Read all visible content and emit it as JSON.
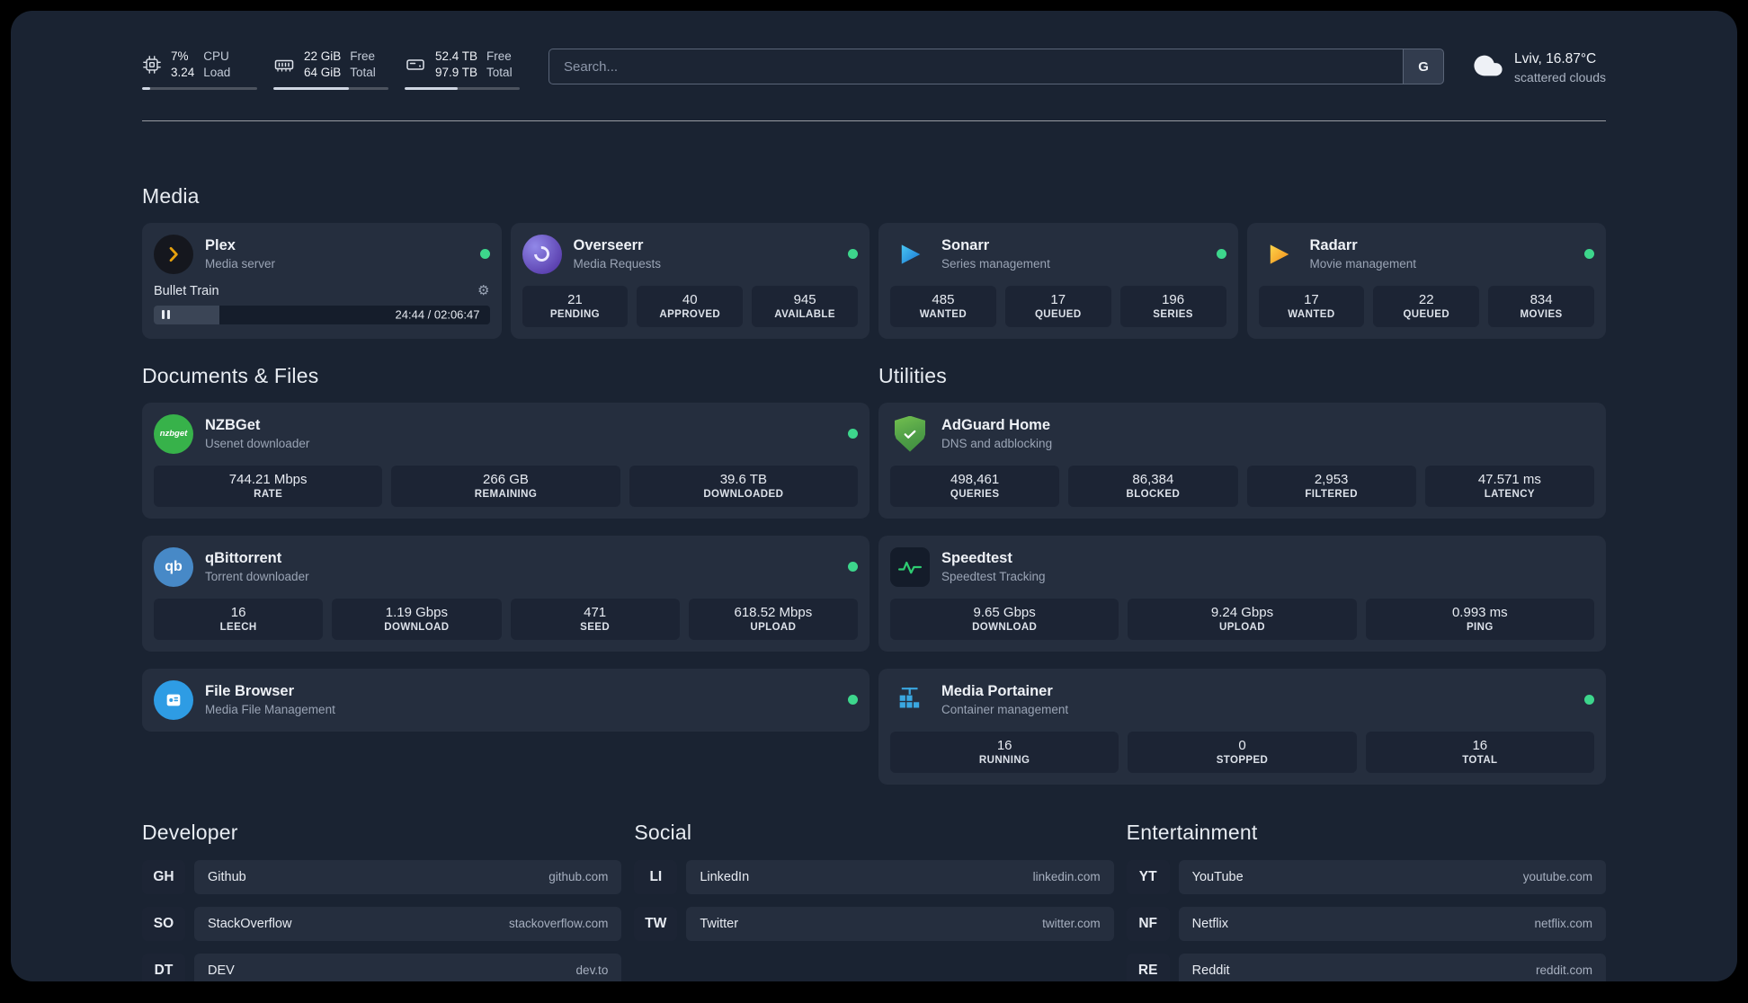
{
  "colors": {
    "status_online": "#3dd68c"
  },
  "icons": {
    "gear": "⚙"
  },
  "header": {
    "cpu": {
      "value_top": "7%",
      "value_bottom": "3.24",
      "label_top": "CPU",
      "label_bottom": "Load",
      "bar_percent": 7
    },
    "memory": {
      "value_top": "22 GiB",
      "value_bottom": "64 GiB",
      "label_top": "Free",
      "label_bottom": "Total",
      "bar_percent": 66
    },
    "disk": {
      "value_top": "52.4 TB",
      "value_bottom": "97.9 TB",
      "label_top": "Free",
      "label_bottom": "Total",
      "bar_percent": 46
    },
    "search": {
      "placeholder": "Search...",
      "button_label": "G"
    },
    "weather": {
      "location": "Lviv, 16.87°C",
      "condition": "scattered clouds"
    }
  },
  "media": {
    "title": "Media",
    "plex": {
      "name": "Plex",
      "subtitle": "Media server",
      "now_playing": {
        "title": "Bullet Train",
        "time": "24:44 / 02:06:47",
        "progress_percent": 19.5
      }
    },
    "overseerr": {
      "name": "Overseerr",
      "subtitle": "Media Requests",
      "stats": [
        {
          "value": "21",
          "label": "PENDING"
        },
        {
          "value": "40",
          "label": "APPROVED"
        },
        {
          "value": "945",
          "label": "AVAILABLE"
        }
      ]
    },
    "sonarr": {
      "name": "Sonarr",
      "subtitle": "Series management",
      "stats": [
        {
          "value": "485",
          "label": "WANTED"
        },
        {
          "value": "17",
          "label": "QUEUED"
        },
        {
          "value": "196",
          "label": "SERIES"
        }
      ]
    },
    "radarr": {
      "name": "Radarr",
      "subtitle": "Movie management",
      "stats": [
        {
          "value": "17",
          "label": "WANTED"
        },
        {
          "value": "22",
          "label": "QUEUED"
        },
        {
          "value": "834",
          "label": "MOVIES"
        }
      ]
    }
  },
  "documents": {
    "title": "Documents & Files",
    "nzbget": {
      "name": "NZBGet",
      "subtitle": "Usenet downloader",
      "icon_text": "nzbget",
      "stats": [
        {
          "value": "744.21 Mbps",
          "label": "RATE"
        },
        {
          "value": "266 GB",
          "label": "REMAINING"
        },
        {
          "value": "39.6 TB",
          "label": "DOWNLOADED"
        }
      ]
    },
    "qbittorrent": {
      "name": "qBittorrent",
      "subtitle": "Torrent downloader",
      "icon_text": "qb",
      "stats": [
        {
          "value": "16",
          "label": "LEECH"
        },
        {
          "value": "1.19 Gbps",
          "label": "DOWNLOAD"
        },
        {
          "value": "471",
          "label": "SEED"
        },
        {
          "value": "618.52 Mbps",
          "label": "UPLOAD"
        }
      ]
    },
    "filebrowser": {
      "name": "File Browser",
      "subtitle": "Media File Management"
    }
  },
  "utilities": {
    "title": "Utilities",
    "adguard": {
      "name": "AdGuard Home",
      "subtitle": "DNS and adblocking",
      "stats": [
        {
          "value": "498,461",
          "label": "QUERIES"
        },
        {
          "value": "86,384",
          "label": "BLOCKED"
        },
        {
          "value": "2,953",
          "label": "FILTERED"
        },
        {
          "value": "47.571 ms",
          "label": "LATENCY"
        }
      ]
    },
    "speedtest": {
      "name": "Speedtest",
      "subtitle": "Speedtest Tracking",
      "stats": [
        {
          "value": "9.65 Gbps",
          "label": "DOWNLOAD"
        },
        {
          "value": "9.24 Gbps",
          "label": "UPLOAD"
        },
        {
          "value": "0.993 ms",
          "label": "PING"
        }
      ]
    },
    "portainer": {
      "name": "Media Portainer",
      "subtitle": "Container management",
      "stats": [
        {
          "value": "16",
          "label": "RUNNING"
        },
        {
          "value": "0",
          "label": "STOPPED"
        },
        {
          "value": "16",
          "label": "TOTAL"
        }
      ]
    }
  },
  "bookmarks": {
    "developer": {
      "title": "Developer",
      "items": [
        {
          "abbr": "GH",
          "name": "Github",
          "domain": "github.com"
        },
        {
          "abbr": "SO",
          "name": "StackOverflow",
          "domain": "stackoverflow.com"
        },
        {
          "abbr": "DT",
          "name": "DEV",
          "domain": "dev.to"
        }
      ]
    },
    "social": {
      "title": "Social",
      "items": [
        {
          "abbr": "LI",
          "name": "LinkedIn",
          "domain": "linkedin.com"
        },
        {
          "abbr": "TW",
          "name": "Twitter",
          "domain": "twitter.com"
        }
      ]
    },
    "entertainment": {
      "title": "Entertainment",
      "items": [
        {
          "abbr": "YT",
          "name": "YouTube",
          "domain": "youtube.com"
        },
        {
          "abbr": "NF",
          "name": "Netflix",
          "domain": "netflix.com"
        },
        {
          "abbr": "RE",
          "name": "Reddit",
          "domain": "reddit.com"
        }
      ]
    }
  }
}
